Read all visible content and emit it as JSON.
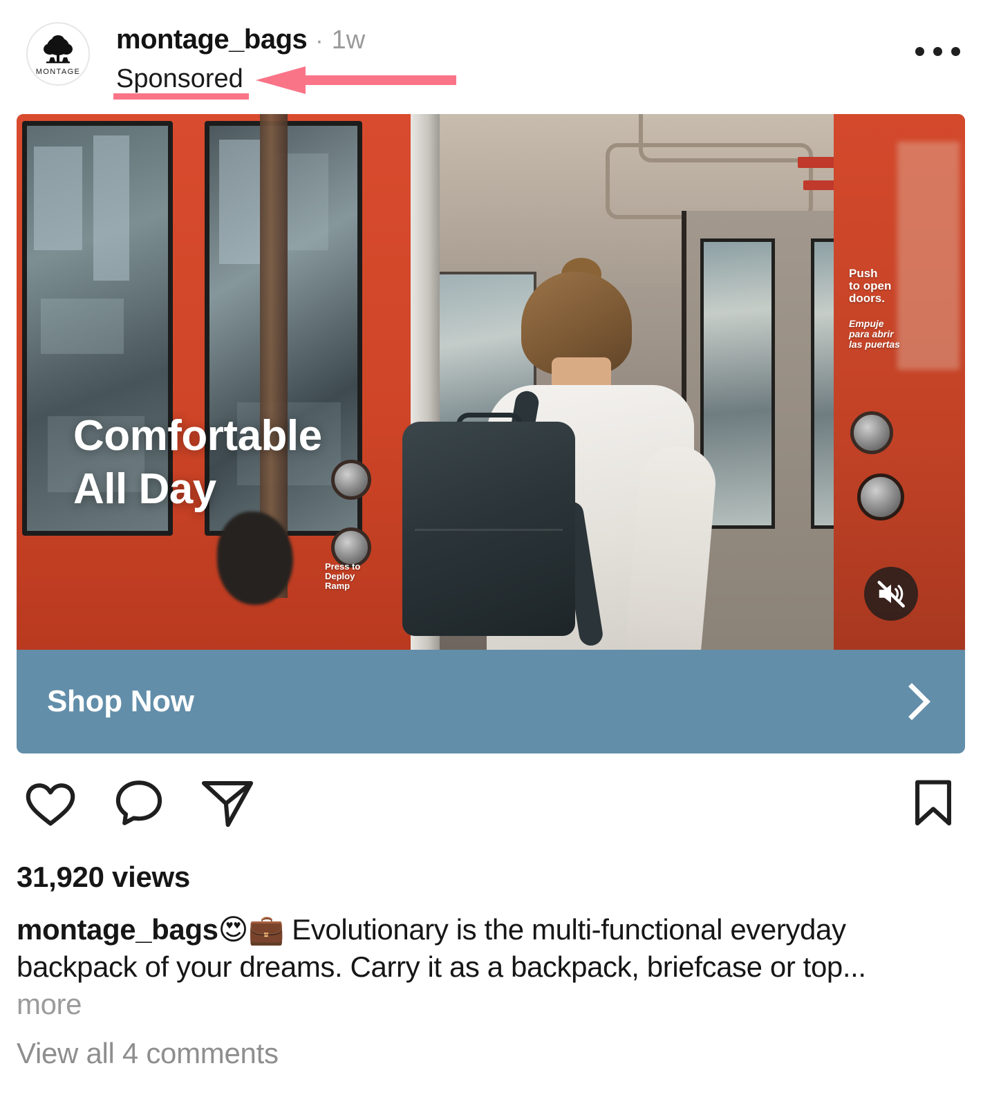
{
  "post": {
    "account": {
      "username": "montage_bags",
      "avatar_brand_text": "MONTAGE",
      "avatar_icon": "tree-logo-icon"
    },
    "timestamp": "1w",
    "separator": "·",
    "sponsored_label": "Sponsored",
    "more_menu_icon": "more-options-icon"
  },
  "annotation": {
    "type": "arrow-pointing-left",
    "color": "#fa7488",
    "underline_color": "#fa7488",
    "target": "Sponsored"
  },
  "media": {
    "type": "video",
    "overlay_line1": "Comfortable",
    "overlay_line2": "All Day",
    "mute_icon": "speaker-muted-icon",
    "scene_text": {
      "door_sign_en": "Push\nto open\ndoors.",
      "door_sign_es": "Empuje\npara abrir\nlas puertas",
      "ramp_sign": "Press to\nDeploy\nRamp"
    }
  },
  "cta": {
    "label": "Shop Now",
    "chevron_icon": "chevron-right-icon",
    "background": "#628ea9"
  },
  "actions": {
    "like_icon": "heart-icon",
    "comment_icon": "comment-bubble-icon",
    "share_icon": "share-paper-plane-icon",
    "save_icon": "bookmark-icon"
  },
  "stats": {
    "views": "31,920 views"
  },
  "caption": {
    "username": "montage_bags",
    "emoji": "😍💼",
    "text": " Evolutionary is the multi-functional everyday backpack of your dreams. Carry it as a backpack, briefcase or top...",
    "more_label": "more"
  },
  "comments": {
    "view_all_label": "View all 4 comments"
  }
}
